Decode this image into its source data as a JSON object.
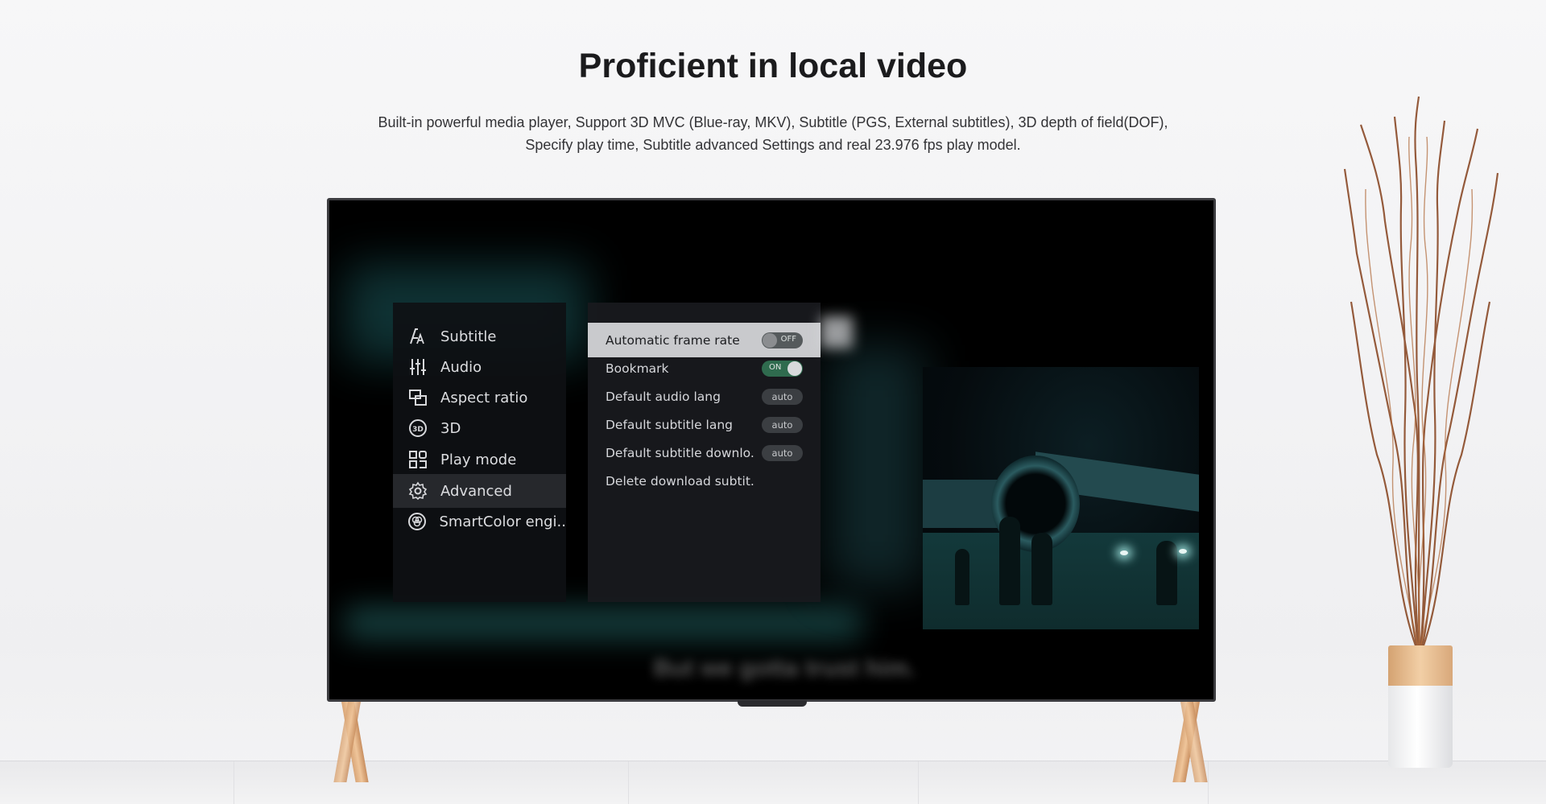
{
  "heading": "Proficient in local video",
  "description": {
    "line1": "Built-in powerful media player, Support 3D MVC (Blue-ray, MKV), Subtitle (PGS, External subtitles), 3D depth of field(DOF),",
    "line2": "Specify play time, Subtitle advanced Settings and real 23.976 fps play model."
  },
  "tv_menu": {
    "left_items": [
      {
        "label": "Subtitle",
        "icon": "font-icon"
      },
      {
        "label": "Audio",
        "icon": "equalizer-icon"
      },
      {
        "label": "Aspect ratio",
        "icon": "aspect-ratio-icon"
      },
      {
        "label": "3D",
        "icon": "3d-icon"
      },
      {
        "label": "Play mode",
        "icon": "play-mode-icon"
      },
      {
        "label": "Advanced",
        "icon": "gear-icon",
        "selected": true
      },
      {
        "label": "SmartColor engi..",
        "icon": "color-wheel-icon"
      }
    ],
    "right_items": [
      {
        "label": "Automatic frame rate",
        "control": "toggle",
        "value": "OFF",
        "focused": true
      },
      {
        "label": "Bookmark",
        "control": "toggle",
        "value": "ON"
      },
      {
        "label": "Default audio lang",
        "control": "pill",
        "value": "auto"
      },
      {
        "label": "Default subtitle lang",
        "control": "pill",
        "value": "auto"
      },
      {
        "label": "Default subtitle downlo..",
        "control": "pill",
        "value": "auto"
      },
      {
        "label": "Delete download subtit..",
        "control": "none"
      }
    ]
  },
  "colors": {
    "accent_on": "#2f6b4e",
    "menu_bg": "#0e1014",
    "leg_wood": "#e8b98a"
  }
}
